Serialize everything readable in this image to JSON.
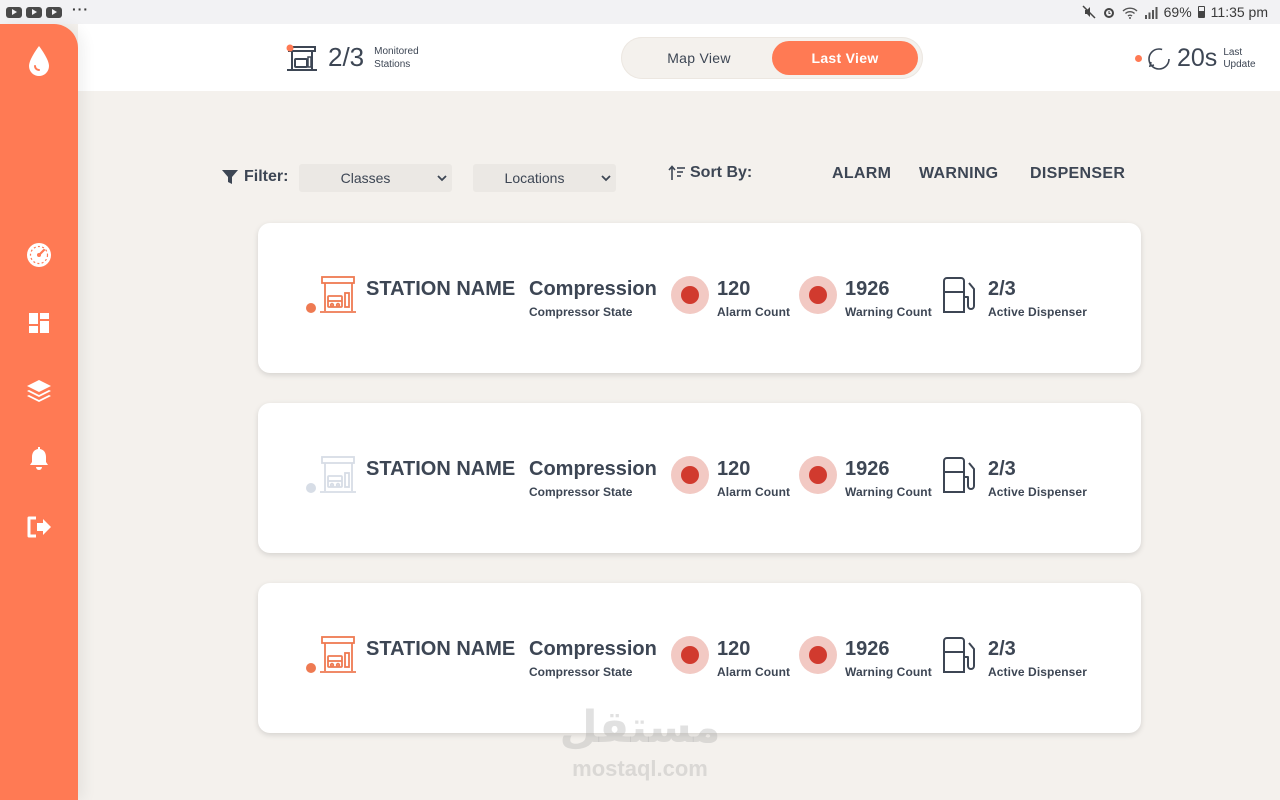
{
  "status_bar": {
    "battery": "69%",
    "time": "11:35 pm",
    "more": "···"
  },
  "sidebar": {
    "items": [
      {
        "icon": "drop-icon"
      },
      {
        "icon": "speedometer-icon"
      },
      {
        "icon": "dashboard-grid-icon"
      },
      {
        "icon": "layers-icon"
      },
      {
        "icon": "bell-icon"
      },
      {
        "icon": "logout-icon"
      }
    ]
  },
  "header": {
    "monitored_count": "2/3",
    "monitored_label": "Monitored Stations",
    "views": {
      "map": "Map View",
      "last": "Last View",
      "active": "last"
    },
    "last_update_value": "20s",
    "last_update_label": "Last Update"
  },
  "filter": {
    "label": "Filter:",
    "classes": "Classes",
    "locations": "Locations",
    "sort_label": "Sort By:",
    "sort_options": [
      "ALARM",
      "WARNING",
      "DISPENSER"
    ]
  },
  "stations": [
    {
      "name": "STATION NAME",
      "compressor_value": "Compression",
      "compressor_label": "Compressor State",
      "alarm_count": "120",
      "alarm_label": "Alarm Count",
      "warning_count": "1926",
      "warning_label": "Warning Count",
      "dispenser": "2/3",
      "dispenser_label": "Active Dispenser",
      "status_color": "#ee7a52"
    },
    {
      "name": "STATION NAME",
      "compressor_value": "Compression",
      "compressor_label": "Compressor State",
      "alarm_count": "120",
      "alarm_label": "Alarm Count",
      "warning_count": "1926",
      "warning_label": "Warning Count",
      "dispenser": "2/3",
      "dispenser_label": "Active Dispenser",
      "status_color": "#d7dde6"
    },
    {
      "name": "STATION NAME",
      "compressor_value": "Compression",
      "compressor_label": "Compressor State",
      "alarm_count": "120",
      "alarm_label": "Alarm Count",
      "warning_count": "1926",
      "warning_label": "Warning Count",
      "dispenser": "2/3",
      "dispenser_label": "Active Dispenser",
      "status_color": "#ee7a52"
    }
  ],
  "colors": {
    "accent": "#ff7a54",
    "text": "#3d4654",
    "alarm": "#d13a2e",
    "background": "#f4f1ed"
  },
  "watermark": {
    "arabic": "مستقل",
    "latin": "mostaql.com"
  }
}
